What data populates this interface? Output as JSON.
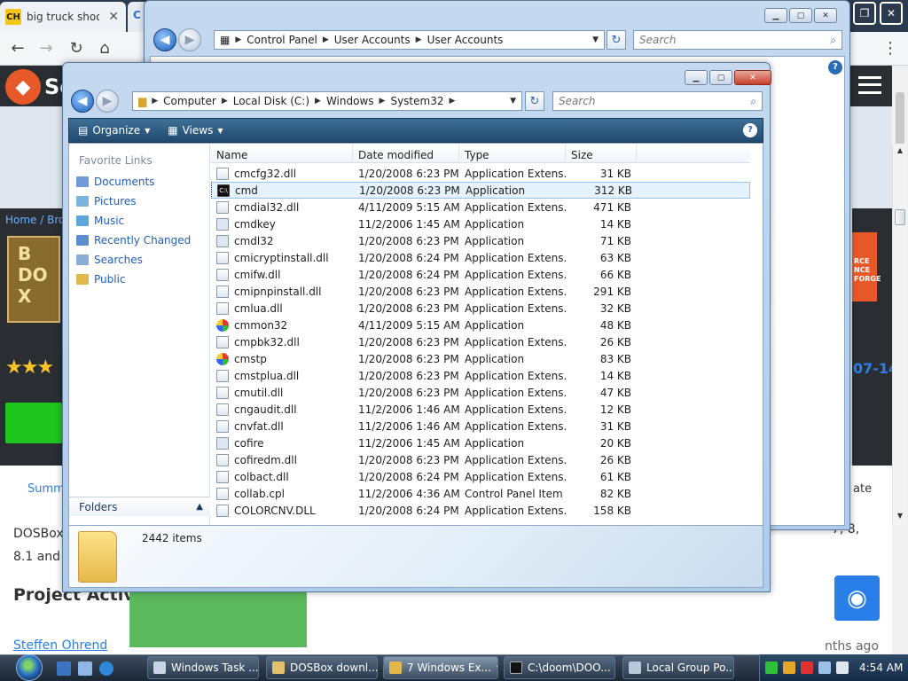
{
  "browser": {
    "tab1_title": "big truck shoot",
    "tab1_favicon": "CH",
    "tab2_partial": "C",
    "close_glyph": "✕",
    "site_logo_letters": "S",
    "site_logo_text": "Sc",
    "breadcrumb": "Home / Brow",
    "project_img_text": "B\nDO\nX",
    "stars": "★★★",
    "date_partial": "07-14",
    "summary_tab": "Summ",
    "right_tab_partial": "ate",
    "desc_line1": "DOSBox",
    "desc_line2": "8.1 and",
    "desc_right": "7, 8,",
    "project_activity": "Project Activi",
    "author": "Steffen Ohrend",
    "months_ago": "nths ago",
    "ad_text": "RCE\nNCE\nFORGE"
  },
  "control_panel": {
    "address": [
      "Control Panel",
      "User Accounts",
      "User Accounts"
    ],
    "search_placeholder": "Search"
  },
  "explorer": {
    "address": [
      "Computer",
      "Local Disk (C:)",
      "Windows",
      "System32"
    ],
    "search_placeholder": "Search",
    "toolbar": {
      "organize": "Organize",
      "views": "Views"
    },
    "favorite_links_header": "Favorite Links",
    "favorite_links": [
      "Documents",
      "Pictures",
      "Music",
      "Recently Changed",
      "Searches",
      "Public"
    ],
    "folders_label": "Folders",
    "columns": {
      "name": "Name",
      "date": "Date modified",
      "type": "Type",
      "size": "Size"
    },
    "files": [
      {
        "name": "cmcfg32.dll",
        "date": "1/20/2008 6:23 PM",
        "type": "Application Extens...",
        "size": "31 KB",
        "icon": "dll"
      },
      {
        "name": "cmd",
        "date": "1/20/2008 6:23 PM",
        "type": "Application",
        "size": "312 KB",
        "icon": "cmd",
        "selected": true
      },
      {
        "name": "cmdial32.dll",
        "date": "4/11/2009 5:15 AM",
        "type": "Application Extens...",
        "size": "471 KB",
        "icon": "dll"
      },
      {
        "name": "cmdkey",
        "date": "11/2/2006 1:45 AM",
        "type": "Application",
        "size": "14 KB",
        "icon": "app"
      },
      {
        "name": "cmdl32",
        "date": "1/20/2008 6:23 PM",
        "type": "Application",
        "size": "71 KB",
        "icon": "app"
      },
      {
        "name": "cmicryptinstall.dll",
        "date": "1/20/2008 6:24 PM",
        "type": "Application Extens...",
        "size": "63 KB",
        "icon": "dll"
      },
      {
        "name": "cmifw.dll",
        "date": "1/20/2008 6:24 PM",
        "type": "Application Extens...",
        "size": "66 KB",
        "icon": "dll"
      },
      {
        "name": "cmipnpinstall.dll",
        "date": "1/20/2008 6:23 PM",
        "type": "Application Extens...",
        "size": "291 KB",
        "icon": "dll"
      },
      {
        "name": "cmlua.dll",
        "date": "1/20/2008 6:23 PM",
        "type": "Application Extens...",
        "size": "32 KB",
        "icon": "dll"
      },
      {
        "name": "cmmon32",
        "date": "4/11/2009 5:15 AM",
        "type": "Application",
        "size": "48 KB",
        "icon": "color"
      },
      {
        "name": "cmpbk32.dll",
        "date": "1/20/2008 6:23 PM",
        "type": "Application Extens...",
        "size": "26 KB",
        "icon": "dll"
      },
      {
        "name": "cmstp",
        "date": "1/20/2008 6:23 PM",
        "type": "Application",
        "size": "83 KB",
        "icon": "color"
      },
      {
        "name": "cmstplua.dll",
        "date": "1/20/2008 6:23 PM",
        "type": "Application Extens...",
        "size": "14 KB",
        "icon": "dll"
      },
      {
        "name": "cmutil.dll",
        "date": "1/20/2008 6:23 PM",
        "type": "Application Extens...",
        "size": "47 KB",
        "icon": "dll"
      },
      {
        "name": "cngaudit.dll",
        "date": "11/2/2006 1:46 AM",
        "type": "Application Extens...",
        "size": "12 KB",
        "icon": "dll"
      },
      {
        "name": "cnvfat.dll",
        "date": "11/2/2006 1:46 AM",
        "type": "Application Extens...",
        "size": "31 KB",
        "icon": "dll"
      },
      {
        "name": "cofire",
        "date": "11/2/2006 1:45 AM",
        "type": "Application",
        "size": "20 KB",
        "icon": "app"
      },
      {
        "name": "cofiredm.dll",
        "date": "1/20/2008 6:23 PM",
        "type": "Application Extens...",
        "size": "26 KB",
        "icon": "dll"
      },
      {
        "name": "colbact.dll",
        "date": "1/20/2008 6:24 PM",
        "type": "Application Extens...",
        "size": "61 KB",
        "icon": "dll"
      },
      {
        "name": "collab.cpl",
        "date": "11/2/2006 4:36 AM",
        "type": "Control Panel Item",
        "size": "82 KB",
        "icon": "dll"
      },
      {
        "name": "COLORCNV.DLL",
        "date": "1/20/2008 6:24 PM",
        "type": "Application Extens...",
        "size": "158 KB",
        "icon": "dll"
      }
    ],
    "item_count": "2442 items"
  },
  "taskbar": {
    "buttons": [
      "Windows Task ...",
      "DOSBox downl...",
      "7 Windows Ex...",
      "C:\\doom\\DOO...",
      "Local Group Po..."
    ],
    "clock": "4:54 AM"
  },
  "colors": {
    "sf_orange": "#e8592a",
    "sf_dark": "#2a2d31",
    "link_blue": "#2a7ee8",
    "green": "#1fc51f"
  }
}
